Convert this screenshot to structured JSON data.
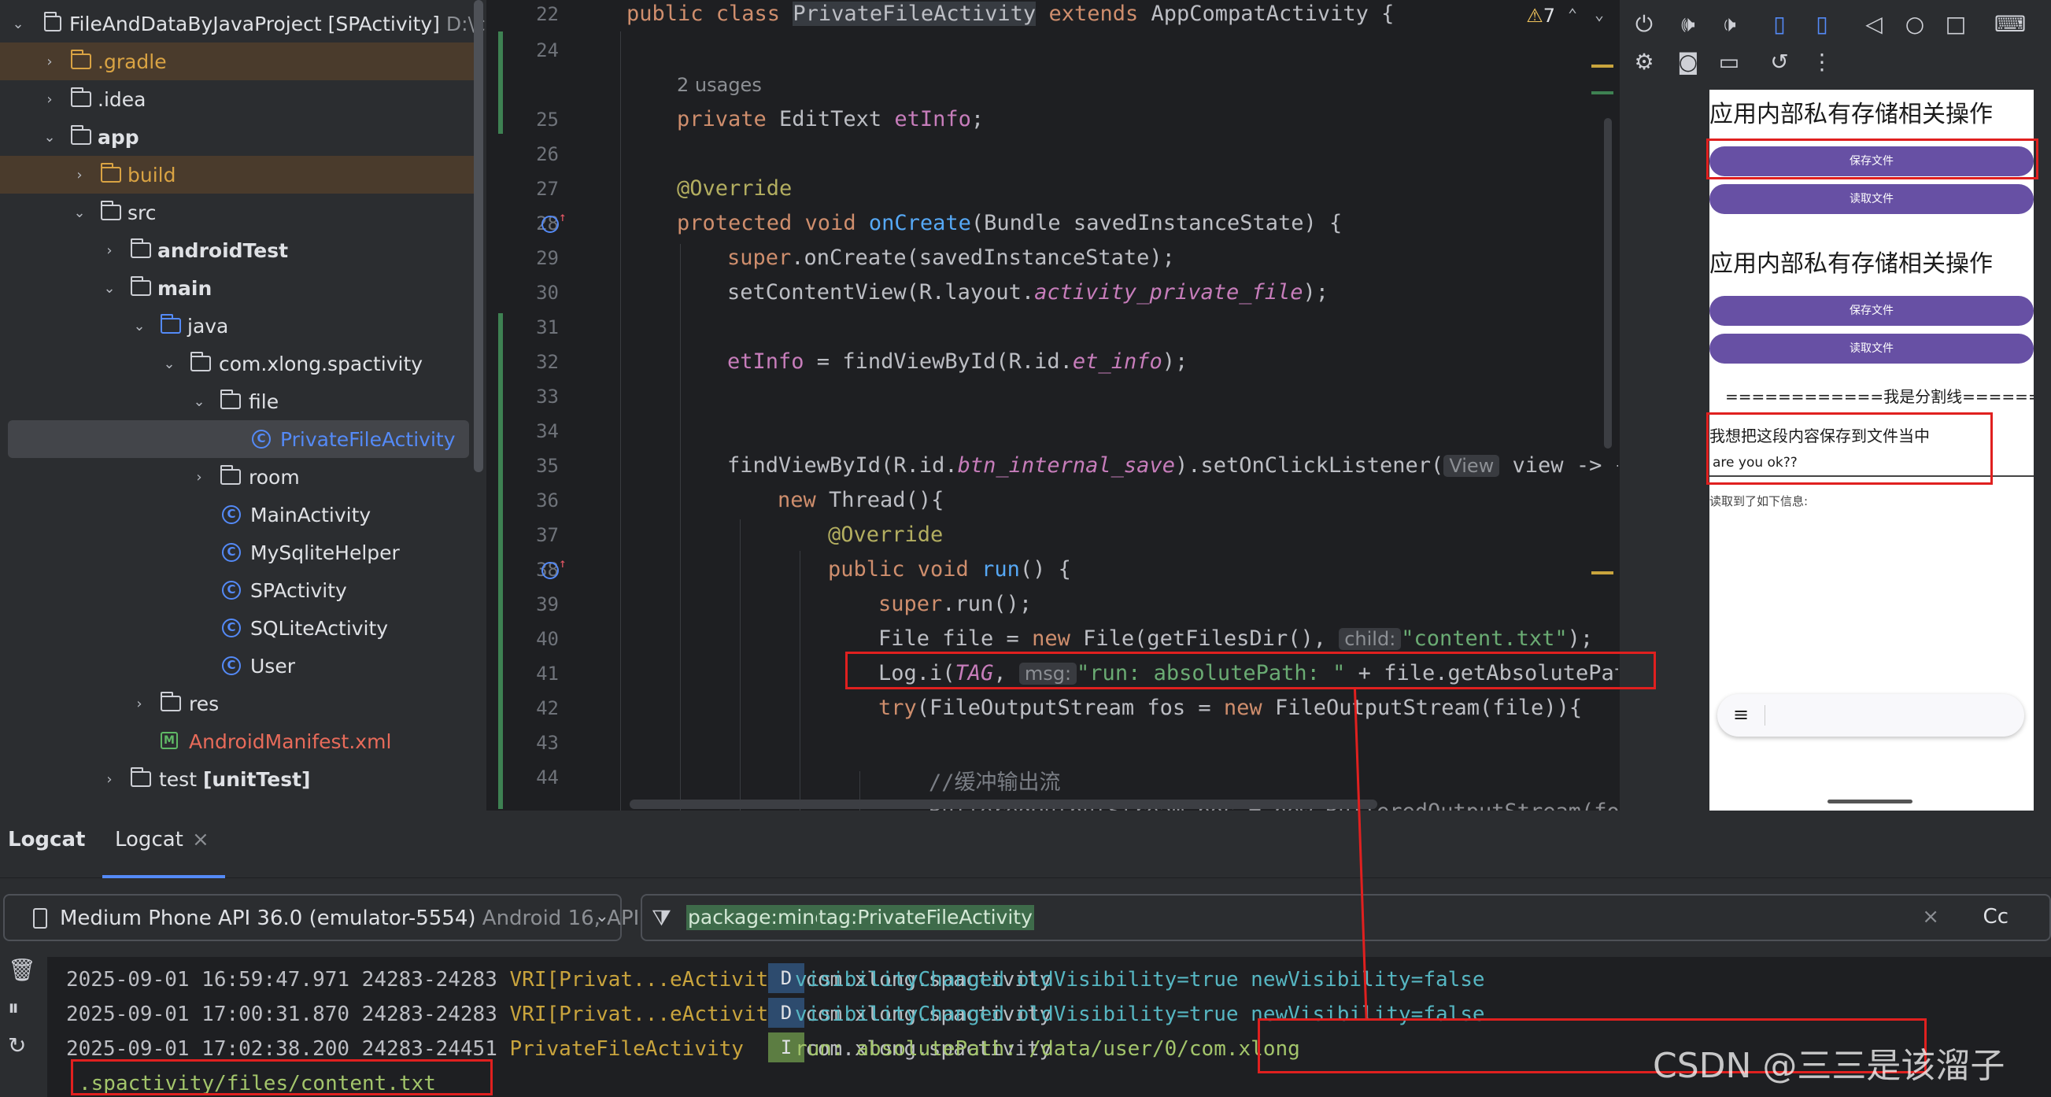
{
  "project_tree": {
    "items": [
      {
        "label": "FileAndDataByJavaProject [SPActivity]",
        "suffix": "D:\\cod"
      },
      {
        "label": ".gradle"
      },
      {
        "label": ".idea"
      },
      {
        "label": "app"
      },
      {
        "label": "build"
      },
      {
        "label": "src"
      },
      {
        "label": "androidTest"
      },
      {
        "label": "main"
      },
      {
        "label": "java"
      },
      {
        "label": "com.xlong.spactivity"
      },
      {
        "label": "file"
      },
      {
        "label": "PrivateFileActivity"
      },
      {
        "label": "room"
      },
      {
        "label": "MainActivity"
      },
      {
        "label": "MySqliteHelper"
      },
      {
        "label": "SPActivity"
      },
      {
        "label": "SQLiteActivity"
      },
      {
        "label": "User"
      },
      {
        "label": "res"
      },
      {
        "label": "AndroidManifest.xml"
      },
      {
        "label": "test",
        "suffix": "[unitTest]"
      }
    ]
  },
  "editor": {
    "warning_count": "7",
    "usages": "2 usages",
    "line_numbers": [
      "22",
      "24",
      "",
      "25",
      "26",
      "27",
      "28",
      "29",
      "30",
      "31",
      "32",
      "33",
      "34",
      "35",
      "36",
      "37",
      "38",
      "39",
      "40",
      "41",
      "42",
      "43",
      "44"
    ],
    "hints": {
      "view": "View",
      "child": "child:",
      "msg": "msg:"
    },
    "lines": {
      "l22_kw": "public class ",
      "l22_name": "PrivateFileActivity",
      "l22_ext": " extends ",
      "l22_rest": "AppCompatActivity {",
      "l25_kw": "private ",
      "l25_type": "EditText ",
      "l25_field": "etInfo",
      "l25_end": ";",
      "l27": "@Override",
      "l28_kw": "protected void ",
      "l28_fn": "onCreate",
      "l28_rest": "(Bundle savedInstanceState) {",
      "l29_kw": "super",
      "l29_rest": ".onCreate(savedInstanceState);",
      "l30_a": "setContentView(R.layout.",
      "l30_b": "activity_private_file",
      "l30_c": ");",
      "l32_field": "etInfo",
      "l32_a": " = findViewById(R.id.",
      "l32_b": "et_info",
      "l32_c": ");",
      "l35_a": "findViewById(R.id.",
      "l35_b": "btn_internal_save",
      "l35_c": ").setOnClickListener(",
      "l35_d": " view -> {",
      "l36_kw": "new ",
      "l36_rest": "Thread(){",
      "l37": "@Override",
      "l38_kw": "public void ",
      "l38_fn": "run",
      "l38_rest": "() {",
      "l39_kw": "super",
      "l39_rest": ".run();",
      "l40_a": "File file = ",
      "l40_kw": "new ",
      "l40_b": "File(getFilesDir(), ",
      "l40_str": "\"content.txt\"",
      "l40_c": ");",
      "l41_a": "Log.i(",
      "l41_tag": "TAG",
      "l41_b": ", ",
      "l41_str": "\"run: absolutePath: \"",
      "l41_c": " + file.getAbsolutePat",
      "l42_kw": "try",
      "l42_a": "(FileOutputStream fos = ",
      "l42_kw2": "new ",
      "l42_b": "FileOutputStream(file)){",
      "l44": "//缓冲输出流",
      "l45": "BufferedOutputStream bos = new BufferedOutputStream(fos"
    }
  },
  "emulator": {
    "title1": "应用内部私有存储相关操作",
    "btn_save1": "保存文件",
    "btn_read1": "读取文件",
    "title2": "应用内部私有存储相关操作",
    "btn_save2": "保存文件",
    "btn_read2": "读取文件",
    "divider": "============我是分割线==========",
    "hint_text": "我想把这段内容保存到文件当中",
    "input_value": "are you ok??",
    "read_label": "读取到了如下信息:"
  },
  "logcat": {
    "tab_main": "Logcat",
    "tab_sub": "Logcat",
    "device_name": "Medium Phone API 36.0 (emulator-5554)",
    "device_extra": " Android 16, API",
    "filter_chips": [
      "package:mine",
      "tag:PrivateFileActivity"
    ],
    "cc_label": "Cc",
    "rows": [
      {
        "time": "2025-09-01 16:59:47.971 24283-24283",
        "tag": "VRI[Privat...eActivity]",
        "pkg": "com.xlong.spactivity",
        "level": "D",
        "msg": "visibilityChanged oldVisibility=true newVisibility=false"
      },
      {
        "time": "2025-09-01 17:00:31.870 24283-24283",
        "tag": "VRI[Privat...eActivity]",
        "pkg": "com.xlong.spactivity",
        "level": "D",
        "msg": "visibilityChanged oldVisibility=true newVisibility=false"
      },
      {
        "time": "2025-09-01 17:02:38.200 24283-24451",
        "tag": "PrivateFileActivity",
        "pkg": "com.xlong.spactivity",
        "level": "I",
        "msg": "run: absolutePath: /data/user/0/com.xlong"
      }
    ],
    "wrap_line": ".spactivity/files/content.txt"
  },
  "watermark": "CSDN @三三是该溜子",
  "colors": {
    "accent": "#548af7",
    "annotation_red": "#e0201f",
    "button_purple": "#6750a4"
  }
}
